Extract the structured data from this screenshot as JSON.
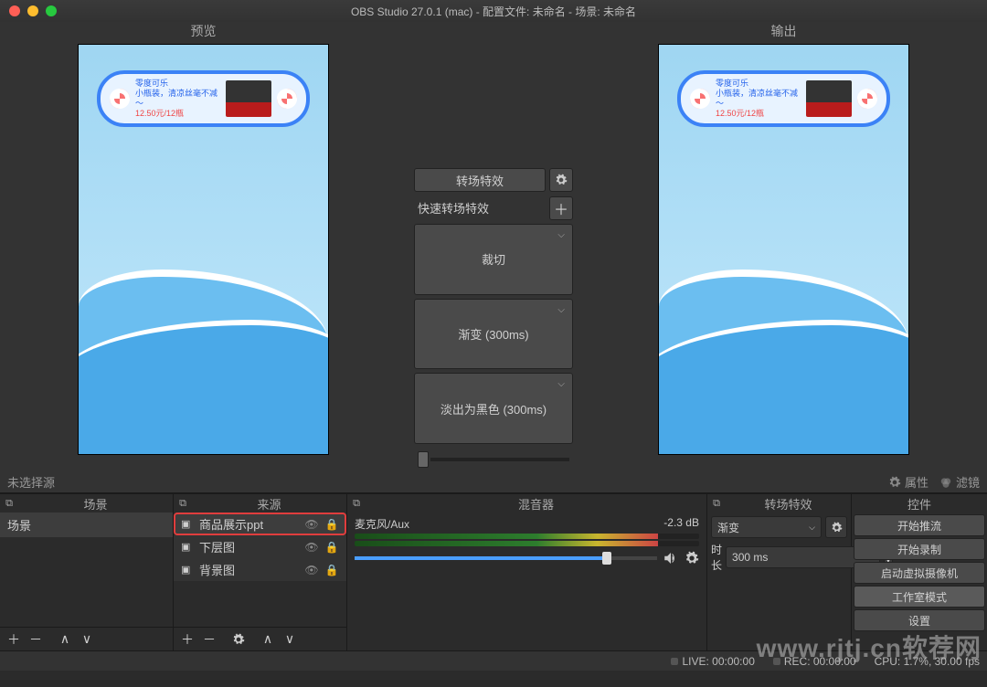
{
  "titlebar": {
    "text": "OBS Studio 27.0.1 (mac) - 配置文件: 未命名 - 场景: 未命名"
  },
  "panes": {
    "preview": "预览",
    "output": "输出"
  },
  "product": {
    "title": "零度可乐",
    "desc": "小瓶装，清凉丝毫不减～",
    "price": "12.50元/12瓶"
  },
  "center": {
    "transition_btn": "转场特效",
    "quick_label": "快速转场特效",
    "cut": "裁切",
    "fade": "渐变 (300ms)",
    "fadeblack": "淡出为黑色 (300ms)"
  },
  "selection_bar": {
    "no_source": "未选择源",
    "properties": "属性",
    "filters": "滤镜"
  },
  "docks": {
    "scenes": {
      "title": "场景",
      "items": [
        "场景"
      ]
    },
    "sources": {
      "title": "来源",
      "items": [
        {
          "name": "商品展示ppt",
          "selected": true
        },
        {
          "name": "下层图",
          "selected": false
        },
        {
          "name": "背景图",
          "selected": false
        }
      ]
    },
    "mixer": {
      "title": "混音器",
      "mic_label": "麦克风/Aux",
      "mic_db": "-2.3 dB"
    },
    "transition": {
      "title": "转场特效",
      "select": "渐变",
      "duration_label": "时长",
      "duration_value": "300 ms"
    },
    "controls": {
      "title": "控件",
      "buttons": [
        "开始推流",
        "开始录制",
        "启动虚拟摄像机",
        "工作室模式",
        "设置"
      ],
      "active_index": 3
    }
  },
  "statusbar": {
    "live": "LIVE: 00:00:00",
    "rec": "REC: 00:00:00",
    "cpu": "CPU: 1.7%, 30.00 fps"
  },
  "watermark": "www.rjtj.cn软荐网"
}
